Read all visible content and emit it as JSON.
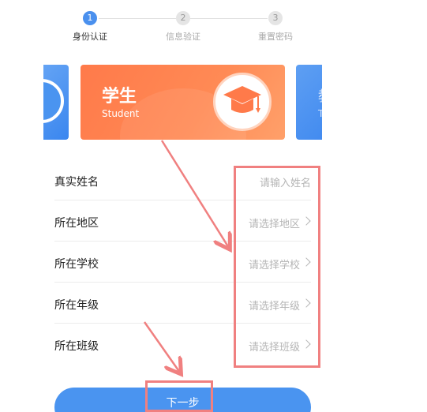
{
  "steps": [
    {
      "number": "1",
      "label": "身份认证",
      "state": "active"
    },
    {
      "number": "2",
      "label": "信息验证",
      "state": "inactive"
    },
    {
      "number": "3",
      "label": "重置密码",
      "state": "inactive"
    }
  ],
  "role_card": {
    "title": "学生",
    "subtitle": "Student",
    "icon": "graduation-cap-icon"
  },
  "side_card": {
    "ghost_title": "教",
    "ghost_sub": "T"
  },
  "form": {
    "rows": [
      {
        "label": "真实姓名",
        "placeholder": "请输入姓名",
        "arrow": false
      },
      {
        "label": "所在地区",
        "placeholder": "请选择地区",
        "arrow": true
      },
      {
        "label": "所在学校",
        "placeholder": "请选择学校",
        "arrow": true
      },
      {
        "label": "所在年级",
        "placeholder": "请选择年级",
        "arrow": true
      },
      {
        "label": "所在班级",
        "placeholder": "请选择班级",
        "arrow": true
      }
    ]
  },
  "next_button": {
    "label": "下一步"
  },
  "colors": {
    "accent": "#4a94f0",
    "card_orange": "#ff8a55",
    "annotation": "#f08080",
    "placeholder": "#b5b5b5"
  }
}
